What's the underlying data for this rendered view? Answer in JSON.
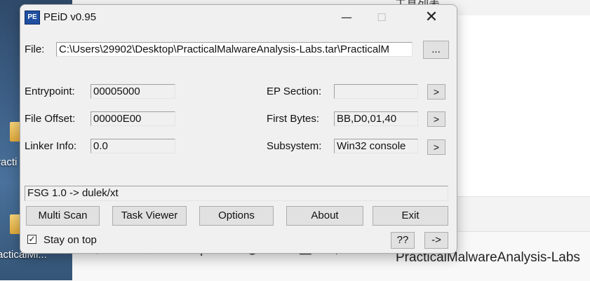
{
  "window": {
    "title": "PEiD v0.95",
    "icon_text": "PE",
    "controls": {
      "minimize": "—",
      "maximize": "☐",
      "close": "✕"
    }
  },
  "file": {
    "label": "File:",
    "path": "C:\\Users\\29902\\Desktop\\PracticalMalwareAnalysis-Labs.tar\\PracticalM",
    "browse_label": "..."
  },
  "fields": {
    "entrypoint": {
      "label": "Entrypoint:",
      "value": "00005000"
    },
    "file_offset": {
      "label": "File Offset:",
      "value": "00000E00"
    },
    "linker_info": {
      "label": "Linker Info:",
      "value": "0.0"
    },
    "ep_section": {
      "label": "EP Section:",
      "value": ""
    },
    "first_bytes": {
      "label": "First Bytes:",
      "value": "BB,D0,01,40"
    },
    "subsystem": {
      "label": "Subsystem:",
      "value": "Win32 console"
    }
  },
  "arrow_label": ">",
  "result": "FSG 1.0 -> dulek/xt",
  "buttons": {
    "multi_scan": "Multi Scan",
    "task_viewer": "Task Viewer",
    "options": "Options",
    "about": "About",
    "exit": "Exit",
    "help": "??",
    "next": "->"
  },
  "stay_on_top": {
    "label": "Stay on top",
    "checked": true,
    "mark": "✓"
  },
  "background": {
    "desktop_labels": [
      "racti",
      "acticalMi..."
    ],
    "explorer_title": "工具列表",
    "explorer_path": "PracticalMalwareAnalysis-Labs",
    "nav_glyphs": {
      "back": "←",
      "forward": "→",
      "up": "↑",
      "refresh": "↻",
      "view": "▭",
      "chevron": "›",
      "more": "···"
    }
  }
}
